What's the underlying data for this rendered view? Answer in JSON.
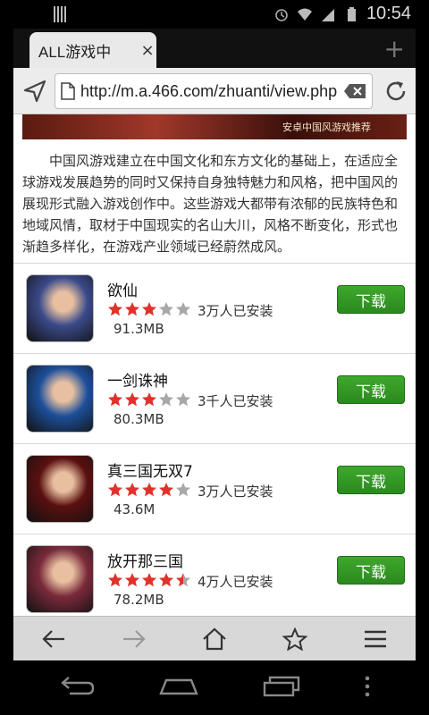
{
  "status": {
    "time": "10:54"
  },
  "tab": {
    "title": "ALL游戏中"
  },
  "address": {
    "url": "http://m.a.466.com/zhuanti/view.php"
  },
  "banner": {
    "caption": "安卓中国风游戏推荐"
  },
  "intro": {
    "text": "中国风游戏建立在中国文化和东方文化的基础上，在适应全球游戏发展趋势的同时又保持自身独特魅力和风格，把中国风的展现形式融入游戏创作中。这些游戏大都带有浓郁的民族特色和地域风情，取材于中国现实的名山大川，风格不断变化，形式也渐趋多样化，在游戏产业领域已经蔚然成风。"
  },
  "games": [
    {
      "name": "欲仙",
      "rating": 3,
      "installs": "3万人已安装",
      "size": "91.3MB",
      "button": "下载",
      "icon_color": "#3a4a8a"
    },
    {
      "name": "一剑诛神",
      "rating": 3,
      "installs": "3千人已安装",
      "size": "80.3MB",
      "button": "下载",
      "icon_color": "#1d4f9a"
    },
    {
      "name": "真三国无双7",
      "rating": 4,
      "installs": "3万人已安装",
      "size": "43.6M",
      "button": "下载",
      "icon_color": "#5a1010"
    },
    {
      "name": "放开那三国",
      "rating": 4.5,
      "installs": "4万人已安装",
      "size": "78.2MB",
      "button": "下载",
      "icon_color": "#7a2a3a"
    }
  ],
  "colors": {
    "star_on": "#e0322a",
    "star_off": "#a8a8a8",
    "download": "#2f951f"
  }
}
